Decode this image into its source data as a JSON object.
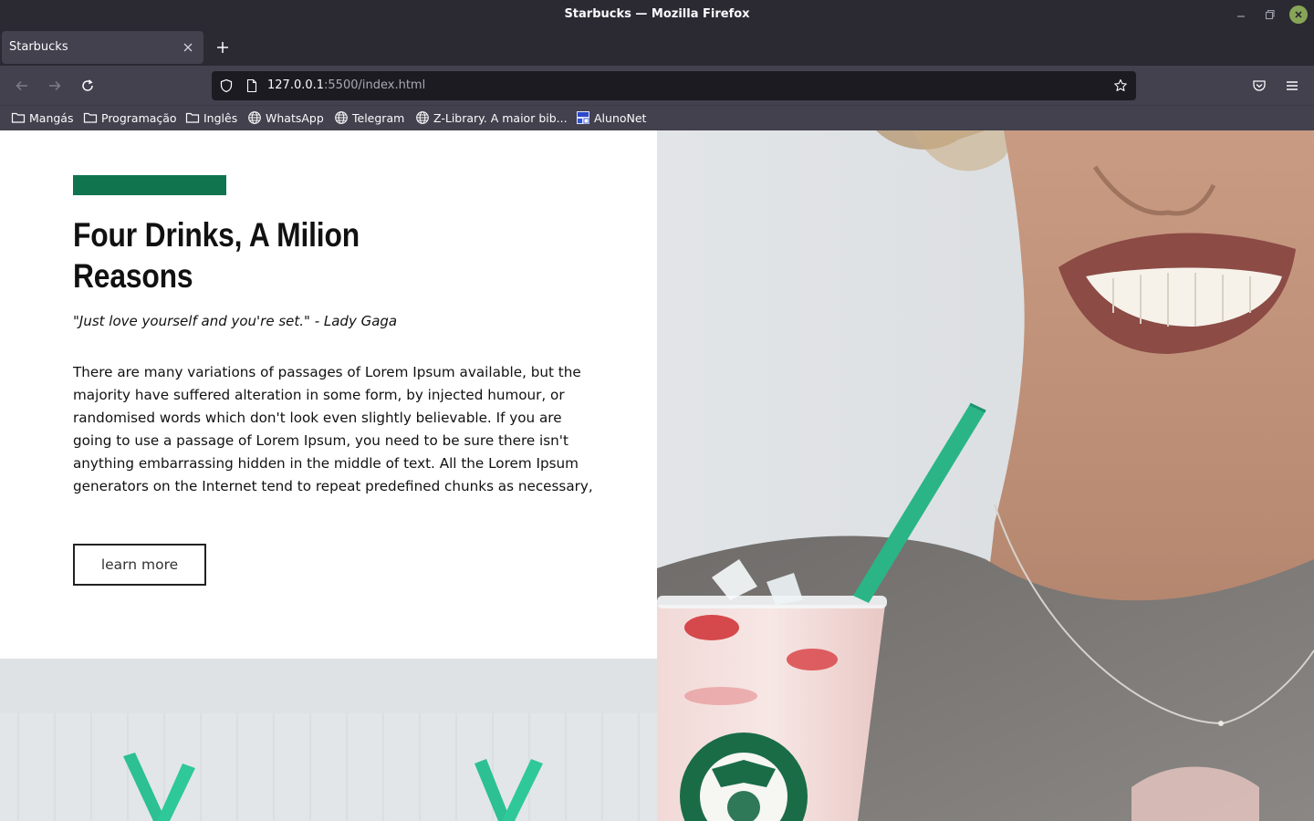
{
  "window": {
    "title": "Starbucks — Mozilla Firefox"
  },
  "tabs": [
    {
      "label": "Starbucks",
      "active": true
    }
  ],
  "navbar": {
    "url_host": "127.0.0.1",
    "url_path": ":5500/index.html"
  },
  "bookmarks": [
    {
      "label": "Mangás",
      "icon": "folder-icon"
    },
    {
      "label": "Programação",
      "icon": "folder-icon"
    },
    {
      "label": "Inglês",
      "icon": "folder-icon"
    },
    {
      "label": "WhatsApp",
      "icon": "globe-icon"
    },
    {
      "label": "Telegram",
      "icon": "globe-icon"
    },
    {
      "label": "Z-Library. A maior bib...",
      "icon": "globe-icon"
    },
    {
      "label": "AlunoNet",
      "icon": "alunonet-favicon"
    }
  ],
  "page": {
    "headline_line1": "Four Drinks, A Milion",
    "headline_line2": "Reasons",
    "quote": "\"Just love yourself and you're set.\" - Lady Gaga",
    "body": "There are many variations of passages of Lorem Ipsum available, but the majority have suffered alteration in some form, by injected humour, or randomised words which don't look even slightly believable. If you are going to use a passage of Lorem Ipsum, you need to be sure there isn't anything embarrassing hidden in the middle of text. All the Lorem Ipsum generators on the Internet tend to repeat predefined chunks as necessary,",
    "button_label": "learn more"
  },
  "colors": {
    "accent_green": "#10754f",
    "straw_green": "#2bb587",
    "chrome_dark": "#2b2a33",
    "chrome_toolbar": "#42414d"
  }
}
